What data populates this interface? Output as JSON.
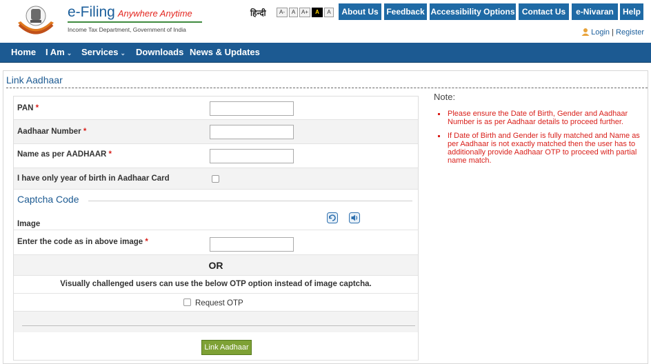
{
  "header": {
    "brand_title": "e-Filing",
    "brand_tagline": "Anywhere Anytime",
    "brand_subtitle": "Income Tax Department, Government of India",
    "language_link": "हिन्दी",
    "font_sizes": [
      "A-",
      "A",
      "A+",
      "A",
      "A"
    ],
    "top_nav": [
      "About Us",
      "Feedback",
      "Accessibility Options",
      "Contact Us",
      "e-Nivaran",
      "Help"
    ],
    "login_label": "Login",
    "separator": "|",
    "register_label": "Register"
  },
  "main_nav": {
    "items": [
      "Home",
      "I Am",
      "Services",
      "Downloads",
      "News & Updates"
    ],
    "dropdown_glyph": "⌄"
  },
  "page": {
    "title": "Link Aadhaar"
  },
  "form": {
    "pan_label": "PAN",
    "aadhaar_label": "Aadhaar Number",
    "name_label": "Name as per AADHAAR",
    "yob_label": "I have only year of birth in Aadhaar Card",
    "required_mark": "*",
    "pan_value": "",
    "aadhaar_value": "",
    "name_value": "",
    "captcha_heading": "Captcha Code",
    "image_label": "Image",
    "captcha_code_label": "Enter the code as in above image",
    "captcha_value": "",
    "or_text": "OR",
    "visually_challenged_text": "Visually challenged users can use the below OTP option instead of image captcha.",
    "request_otp_label": "Request OTP",
    "submit_label": "Link Aadhaar"
  },
  "note": {
    "title": "Note:",
    "items": [
      "Please ensure the Date of Birth, Gender and Aadhaar Number is as per Aadhaar details to proceed further.",
      "If Date of Birth and Gender is fully matched and Name as per Aadhaar is not exactly matched then the user has to additionally provide Aadhaar OTP to proceed with partial name match."
    ]
  },
  "colors": {
    "nav_blue": "#1c5a92",
    "top_button_blue": "#1f6aa5",
    "required_red": "#d9201b",
    "submit_green": "#7ea135"
  },
  "icons": [
    "state-emblem-icon",
    "user-icon",
    "refresh-icon",
    "audio-icon"
  ]
}
